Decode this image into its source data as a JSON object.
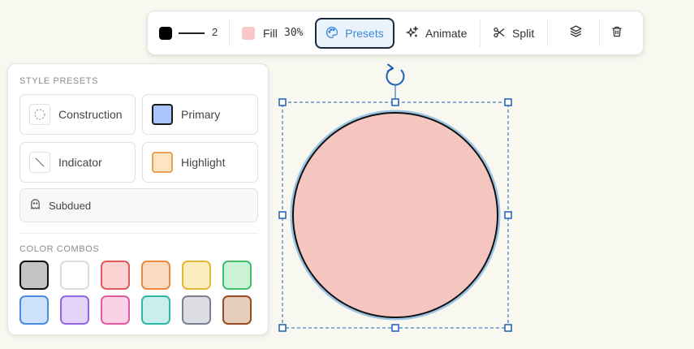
{
  "toolbar": {
    "stroke": {
      "color": "#000000",
      "width": "2"
    },
    "fill": {
      "color": "#f8c8c6",
      "label": "Fill",
      "opacity": "30%"
    },
    "presets_label": "Presets",
    "animate_label": "Animate",
    "split_label": "Split",
    "layers_icon": "layers-icon",
    "delete_icon": "trash-icon"
  },
  "style_panel": {
    "presets_title": "STYLE PRESETS",
    "presets": [
      {
        "label": "Construction",
        "icon": "dashed-circle-icon"
      },
      {
        "label": "Primary",
        "icon": "blue-square-icon"
      },
      {
        "label": "Indicator",
        "icon": "diagonal-line-icon"
      },
      {
        "label": "Highlight",
        "icon": "orange-square-icon"
      },
      {
        "label": "Subdued",
        "icon": "ghost-icon"
      }
    ],
    "combos_title": "COLOR COMBOS",
    "color_combos": [
      {
        "fill": "#c4c4c4",
        "stroke": "#111111",
        "selected": true
      },
      {
        "fill": "#ffffff",
        "stroke": "#dddddd"
      },
      {
        "fill": "#fbd3d3",
        "stroke": "#e0595e"
      },
      {
        "fill": "#fcdcc0",
        "stroke": "#ec8a3e"
      },
      {
        "fill": "#fbeebc",
        "stroke": "#e6b63a"
      },
      {
        "fill": "#ccf2d8",
        "stroke": "#3fc06a"
      },
      {
        "fill": "#cfe2fb",
        "stroke": "#4a8be0"
      },
      {
        "fill": "#e3d3fa",
        "stroke": "#9266dd"
      },
      {
        "fill": "#fbd1e6",
        "stroke": "#e05aa0"
      },
      {
        "fill": "#c9efea",
        "stroke": "#2fb7a6"
      },
      {
        "fill": "#dcdde2",
        "stroke": "#7c7f91"
      },
      {
        "fill": "#e7cdbd",
        "stroke": "#9a4a20"
      }
    ]
  },
  "canvas": {
    "shape": "circle",
    "fill_color": "#f5c6c0",
    "stroke_color": "#111111",
    "selection_color": "#1a5fb4"
  }
}
